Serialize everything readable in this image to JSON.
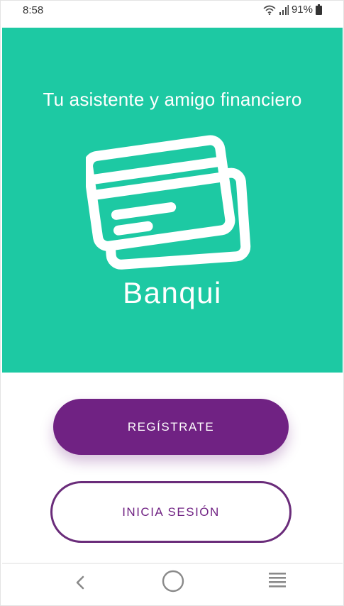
{
  "status_bar": {
    "time": "8:58",
    "battery": "91%",
    "icons": [
      "wifi-icon",
      "signal-icon",
      "battery-icon"
    ]
  },
  "hero": {
    "tagline": "Tu asistente y amigo financiero",
    "icon": "credit-cards-icon",
    "app_name": "Banqui",
    "background_color": "#1dc9a3"
  },
  "actions": {
    "register_label": "REGÍSTRATE",
    "login_label": "INICIA SESIÓN",
    "accent_color": "#702283"
  },
  "nav_bar": {
    "icons": [
      "back-icon",
      "home-icon",
      "recents-icon"
    ]
  }
}
